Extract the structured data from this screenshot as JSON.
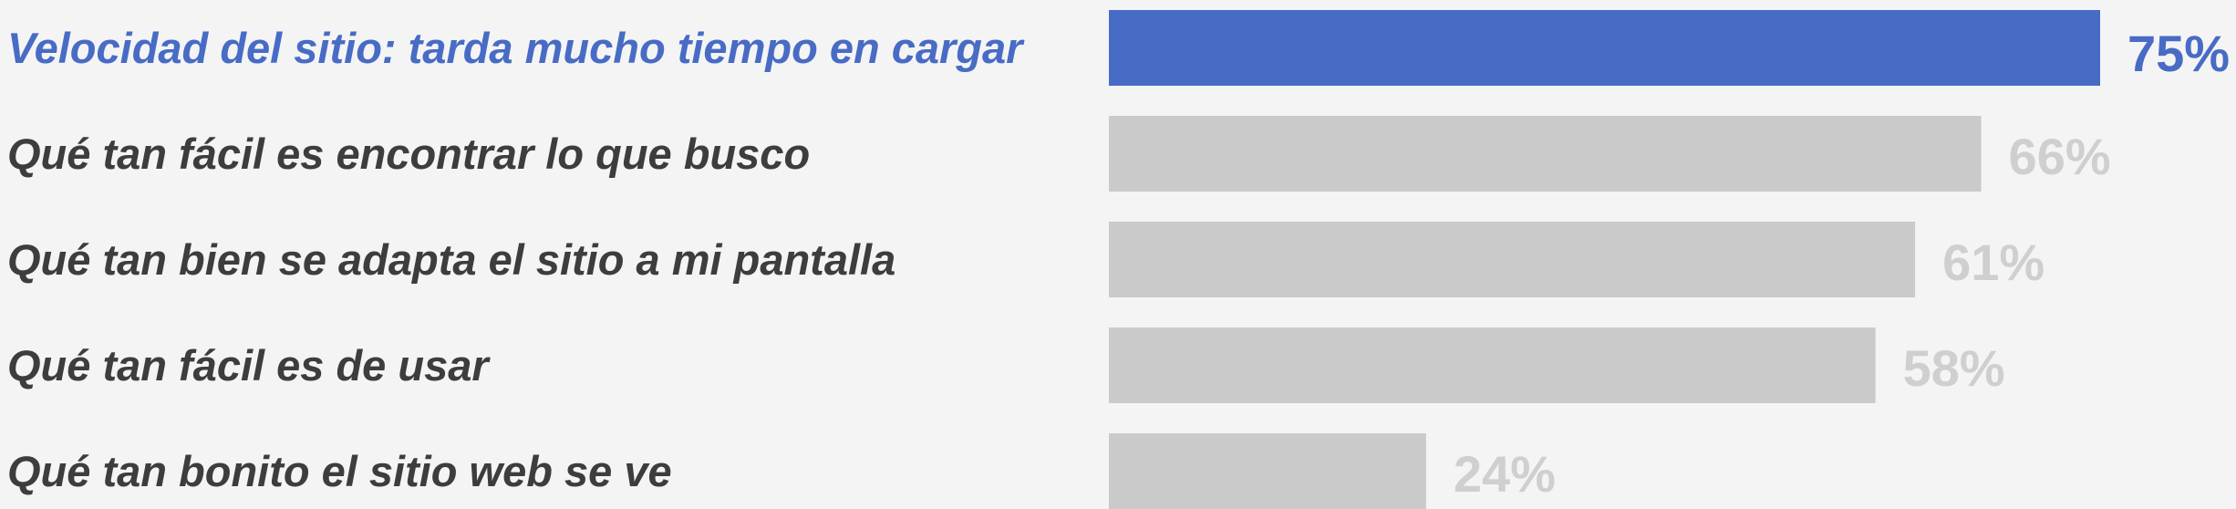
{
  "chart_data": {
    "type": "bar",
    "orientation": "horizontal",
    "categories": [
      "Velocidad del sitio: tarda mucho tiempo en cargar",
      "Qué tan fácil es encontrar lo que busco",
      "Qué tan bien se adapta el sitio a mi pantalla",
      "Qué tan fácil es de usar",
      "Qué tan bonito el sitio web se ve"
    ],
    "values": [
      75,
      66,
      61,
      58,
      24
    ],
    "value_labels": [
      "75%",
      "66%",
      "61%",
      "58%",
      "24%"
    ],
    "unit": "%",
    "highlight_index": 0,
    "colors": {
      "highlight_bar": "#486bc5",
      "highlight_text": "#486bc5",
      "bar": "#cbcaca",
      "label_text": "#3d3d3d",
      "value_text": "#cfcfcf",
      "background": "#f4f4f4"
    }
  }
}
